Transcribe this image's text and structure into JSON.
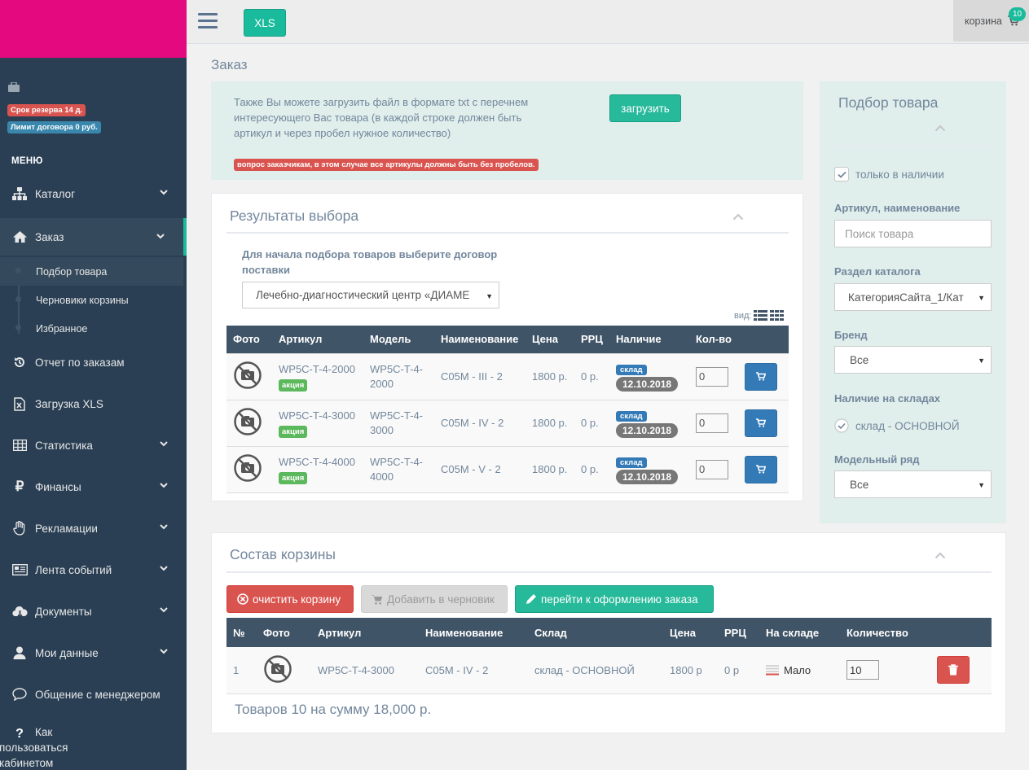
{
  "sidebar": {
    "badge_reserve": "Срок резерва 14 д.",
    "badge_limit": "Лимит договора 0 руб.",
    "menu_title": "МЕНЮ",
    "items": {
      "catalog": "Каталог",
      "order": "Заказ",
      "order_sub_selection": "Подбор товара",
      "order_sub_drafts": "Черновики корзины",
      "order_sub_favorites": "Избранное",
      "report": "Отчет по заказам",
      "upload_xls": "Загрузка XLS",
      "stats": "Статистика",
      "finance": "Финансы",
      "claims": "Рекламации",
      "events": "Лента событий",
      "documents": "Документы",
      "my_data": "Мои данные",
      "manager": "Общение с менеджером",
      "howto": "Как пользоваться кабинетом"
    }
  },
  "topbar": {
    "xls_label": "XLS",
    "cart_label": "корзина",
    "cart_count": "10"
  },
  "page": {
    "title": "Заказ"
  },
  "info": {
    "text": "Также Вы можете загрузить файл в формате txt с перечнем интересующего Вас товара (в каждой строке должен быть артикул и через пробел нужное количество)",
    "upload_label": "загрузить",
    "warning": "вопрос заказчикам, в этом случае все артикулы должны быть без пробелов."
  },
  "results": {
    "title": "Результаты выбора",
    "hint": "Для начала подбора товаров выберите договор поставки",
    "contract_value": "Лечебно-диагностический центр «ДИАМЕ",
    "view_label": "вид:",
    "headers": [
      "Фото",
      "Артикул",
      "Модель",
      "Наименование",
      "Цена",
      "РРЦ",
      "Наличие",
      "Кол-во",
      ""
    ],
    "rows": [
      {
        "article": "WP5C-T-4-2000",
        "promo": "акция",
        "model": "WP5C-T-4-2000",
        "name": "C05M - III - 2",
        "price": "1800 р.",
        "rrc": "0 р.",
        "stock": "склад",
        "date": "12.10.2018",
        "qty": "0"
      },
      {
        "article": "WP5C-T-4-3000",
        "promo": "акция",
        "model": "WP5C-T-4-3000",
        "name": "C05M - IV - 2",
        "price": "1800 р.",
        "rrc": "0 р.",
        "stock": "склад",
        "date": "12.10.2018",
        "qty": "0"
      },
      {
        "article": "WP5C-T-4-4000",
        "promo": "акция",
        "model": "WP5C-T-4-4000",
        "name": "C05M - V - 2",
        "price": "1800 р.",
        "rrc": "0 р.",
        "stock": "склад",
        "date": "12.10.2018",
        "qty": "0"
      }
    ]
  },
  "filter": {
    "title": "Подбор товара",
    "in_stock_label": "только в наличии",
    "article_label": "Артикул, наименование",
    "search_placeholder": "Поиск товара",
    "section_label": "Раздел каталога",
    "section_value": "КатегорияСайта_1/Кат",
    "brand_label": "Бренд",
    "brand_value": "Все",
    "warehouses_label": "Наличие на складах",
    "warehouse_name": "склад - ОСНОВНОЙ",
    "series_label": "Модельный ряд",
    "series_value": "Все"
  },
  "cart": {
    "title": "Состав корзины",
    "clear_label": "очистить корзину",
    "draft_label": "Добавить в черновик",
    "checkout_label": "перейти к оформлению заказа",
    "headers": [
      "№",
      "Фото",
      "Артикул",
      "Наименование",
      "Склад",
      "Цена",
      "РРЦ",
      "На складе",
      "Количество",
      ""
    ],
    "rows": [
      {
        "num": "1",
        "article": "WP5C-T-4-3000",
        "name": "C05M - IV - 2",
        "warehouse": "склад - ОСНОВНОЙ",
        "price": "1800 р",
        "rrc": "0 р",
        "availability": "Мало",
        "qty": "10"
      }
    ],
    "total": "Товаров 10 на сумму 18,000 р."
  },
  "colors": {
    "brand": "#e5097f",
    "sidebar": "#2a3f54",
    "accent": "#1abb9c",
    "primary": "#337ab7",
    "danger": "#d9534f"
  }
}
